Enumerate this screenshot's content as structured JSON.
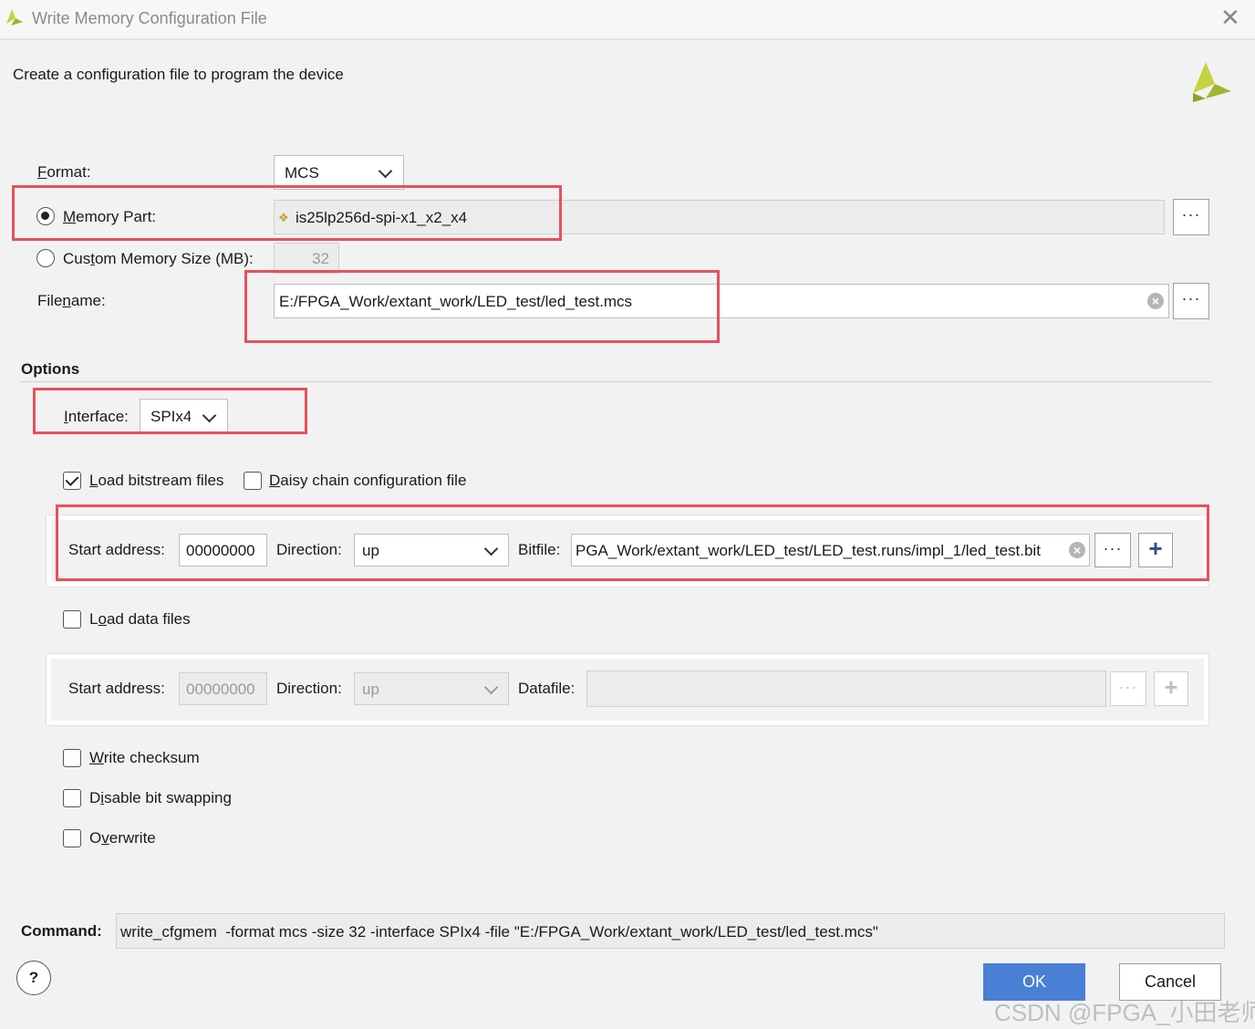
{
  "window": {
    "title": "Write Memory Configuration File",
    "close_glyph": "✕"
  },
  "header": {
    "subtitle": "Create a configuration file to program the device"
  },
  "format": {
    "label_u": "F",
    "label_rest": "ormat:",
    "value": "MCS"
  },
  "memory_part": {
    "label_u": "M",
    "label_rest": "emory Part:",
    "value": "is25lp256d-spi-x1_x2_x4",
    "selected": true
  },
  "custom_size": {
    "label_pre": "Cus",
    "label_u": "t",
    "label_rest": "om Memory Size (MB):",
    "value": "32",
    "selected": false
  },
  "filename": {
    "label_pre": "File",
    "label_u": "n",
    "label_rest": "ame:",
    "value": "E:/FPGA_Work/extant_work/LED_test/led_test.mcs"
  },
  "options": {
    "heading": "Options",
    "interface": {
      "label_u": "I",
      "label_rest": "nterface:",
      "value": "SPIx4"
    },
    "load_bitstream": {
      "label_u": "L",
      "label_rest": "oad bitstream files",
      "checked": true
    },
    "daisy_chain": {
      "label_u": "D",
      "label_rest": "aisy chain configuration file",
      "checked": false
    },
    "bitstream_row": {
      "start_label": "Start address:",
      "start_value": "00000000",
      "direction_label": "Direction:",
      "direction_value": "up",
      "file_label": "Bitfile:",
      "file_value": "PGA_Work/extant_work/LED_test/LED_test.runs/impl_1/led_test.bit"
    },
    "load_data": {
      "label_pre": "L",
      "label_u": "o",
      "label_rest": "ad data files",
      "checked": false
    },
    "data_row": {
      "start_label": "Start address:",
      "start_value": "00000000",
      "direction_label": "Direction:",
      "direction_value": "up",
      "file_label": "Datafile:",
      "file_value": ""
    },
    "write_checksum": {
      "label_u": "W",
      "label_rest": "rite checksum",
      "checked": false
    },
    "disable_bit_swapping": {
      "label_pre": "D",
      "label_u": "i",
      "label_rest": "sable bit swapping",
      "checked": false
    },
    "overwrite": {
      "label_pre": "O",
      "label_u": "v",
      "label_rest": "erwrite",
      "checked": false
    }
  },
  "command": {
    "label": "Command:",
    "value": "write_cfgmem  -format mcs -size 32 -interface SPIx4 -file \"E:/FPGA_Work/extant_work/LED_test/led_test.mcs\""
  },
  "footer": {
    "help": "?",
    "ok": "OK",
    "cancel": "Cancel"
  },
  "watermark": "CSDN @FPGA_小田老师",
  "glyphs": {
    "dots": "···",
    "plus": "+",
    "clear": "×"
  },
  "colors": {
    "accent": "#4a7fd6",
    "highlight": "#e8505a",
    "logo": "#b5c93a"
  }
}
